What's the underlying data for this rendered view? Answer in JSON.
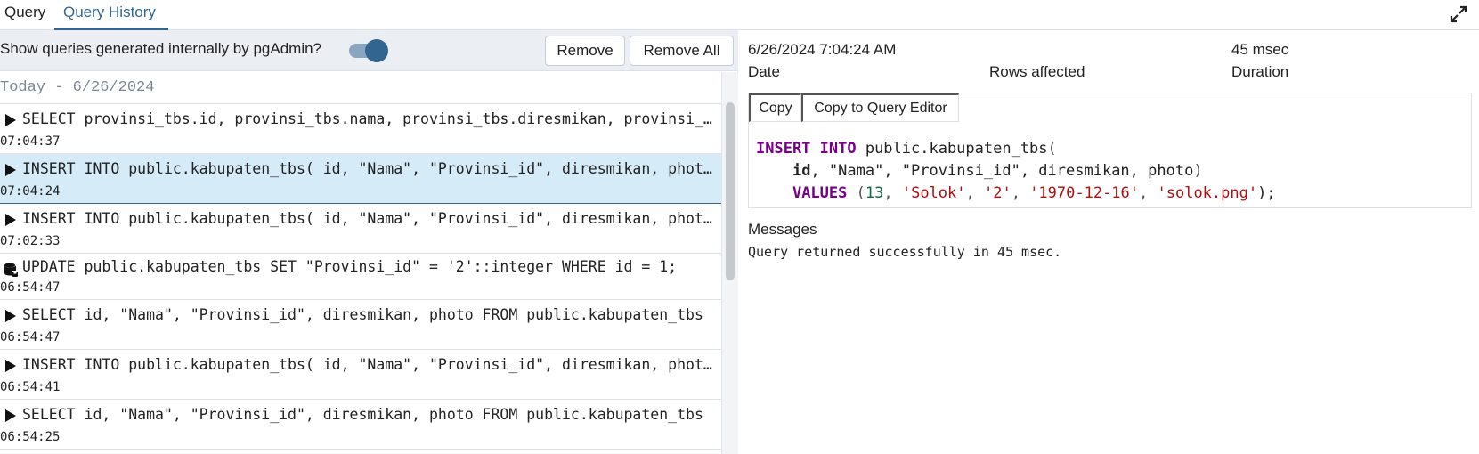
{
  "tabs": [
    {
      "label": "Query",
      "active": false
    },
    {
      "label": "Query History",
      "active": true
    }
  ],
  "toolbar": {
    "show_internal_label": "Show queries generated internally by pgAdmin?",
    "show_internal_enabled": true,
    "remove_label": "Remove",
    "remove_all_label": "Remove All"
  },
  "history": {
    "date_group": "Today - 6/26/2024",
    "entries": [
      {
        "icon": "play-icon",
        "sql": "SELECT provinsi_tbs.id, provinsi_tbs.nama, provinsi_tbs.diresmikan, provinsi_tbs.photo FROM public.provinsi_tbs",
        "time": "07:04:37",
        "selected": false
      },
      {
        "icon": "play-icon",
        "sql": "INSERT INTO public.kabupaten_tbs( id, \"Nama\", \"Provinsi_id\", diresmikan, photo) VALUES (13, 'Solok', '2', '1970-12-16', 'solok.png');",
        "time": "07:04:24",
        "selected": true
      },
      {
        "icon": "play-icon",
        "sql": "INSERT INTO public.kabupaten_tbs( id, \"Nama\", \"Provinsi_id\", diresmikan, photo) VALUES",
        "time": "07:02:33",
        "selected": false
      },
      {
        "icon": "database-save-icon",
        "sql": "UPDATE public.kabupaten_tbs SET \"Provinsi_id\" = '2'::integer WHERE id = 1;",
        "time": "06:54:47",
        "selected": false
      },
      {
        "icon": "play-icon",
        "sql": "SELECT id, \"Nama\", \"Provinsi_id\", diresmikan, photo FROM public.kabupaten_tbs",
        "time": "06:54:47",
        "selected": false
      },
      {
        "icon": "play-icon",
        "sql": "INSERT INTO public.kabupaten_tbs( id, \"Nama\", \"Provinsi_id\", diresmikan, photo) VALUES",
        "time": "06:54:41",
        "selected": false
      },
      {
        "icon": "play-icon",
        "sql": "SELECT id, \"Nama\", \"Provinsi_id\", diresmikan, photo FROM public.kabupaten_tbs",
        "time": "06:54:25",
        "selected": false
      }
    ]
  },
  "detail": {
    "date_value": "6/26/2024 7:04:24 AM",
    "date_label": "Date",
    "rows_affected_label": "Rows affected",
    "duration_value": "45 msec",
    "duration_label": "Duration",
    "copy_label": "Copy",
    "copy_to_editor_label": "Copy to Query Editor",
    "code": {
      "kw_insert": "INSERT INTO",
      "table": " public.kabupaten_tbs",
      "paren_open": "(",
      "col_id": "id",
      "col_rest": ", \"Nama\", \"Provinsi_id\", diresmikan, photo",
      "paren_close": ")",
      "kw_values": "VALUES",
      "num_13": "13",
      "str_solok": "'Solok'",
      "str_2": "'2'",
      "str_date": "'1970-12-16'",
      "str_png": "'solok.png'"
    },
    "messages_label": "Messages",
    "message_text": "Query returned successfully in 45 msec."
  },
  "colors": {
    "accent": "#326690",
    "selected_row": "#d6ebf8",
    "keyword": "#770088",
    "string": "#aa1111",
    "number": "#116644"
  }
}
